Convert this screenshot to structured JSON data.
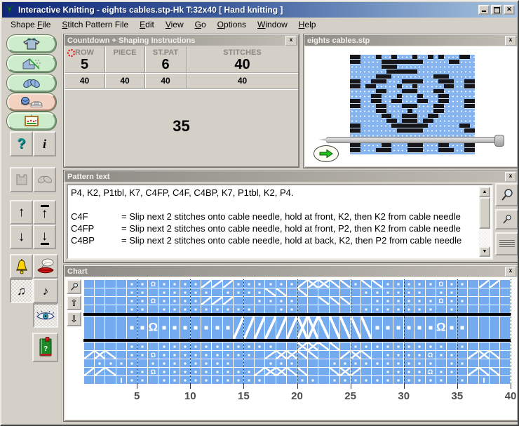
{
  "window": {
    "title": "Interactive Knitting - eights cables.stp-Hk    T:32x40    [ Hand knitting ]",
    "close_glyph": "x"
  },
  "menu": {
    "items": [
      {
        "pre": "Shape ",
        "key": "F",
        "post": "ile"
      },
      {
        "pre": "",
        "key": "S",
        "post": "titch Pattern File"
      },
      {
        "pre": "",
        "key": "E",
        "post": "dit"
      },
      {
        "pre": "",
        "key": "V",
        "post": "iew"
      },
      {
        "pre": "",
        "key": "G",
        "post": "o"
      },
      {
        "pre": "",
        "key": "O",
        "post": "ptions"
      },
      {
        "pre": "",
        "key": "W",
        "post": "indow"
      },
      {
        "pre": "",
        "key": "H",
        "post": "elp"
      }
    ]
  },
  "toolbar": {
    "help_label": "?",
    "info_label": "i",
    "up_label": "↑",
    "down_label": "↓",
    "notes_label": "♫",
    "note_label": "♪",
    "zoom_icon_names": [
      "zoom-in",
      "zoom-out"
    ]
  },
  "countdown": {
    "title": "Countdown + Shaping Instructions",
    "headers": [
      "ROW",
      "PIECE",
      "ST.PAT",
      "STITCHES"
    ],
    "values": [
      "5",
      "",
      "6",
      "40"
    ],
    "row2": [
      "40",
      "40",
      "40",
      "40"
    ],
    "big_value": "35"
  },
  "preview": {
    "title": "eights cables.stp",
    "rows": [
      "##---#--#---#--#-#---##-",
      "##----########-----##---",
      "------###---------------",
      "-------######-----------",
      "-----###--------###-----",
      "##--###---####---###--##",
      "##-##----#--#-----##--##",
      "-----##---###---##------",
      "----##---#---#---##-----",
      "##--##--##---##--##---##",
      "##---##---###---##----##",
      "-----##----#----##------",
      "------##--###--##-------",
      "-------##-###-##--------",
      "##------#######------##-",
      "##-------#####--------##"
    ],
    "rows_below_needle": [
      "##----##---###---##---##",
      "##---###---###---###--##"
    ]
  },
  "pattern_text": {
    "title": "Pattern text",
    "line1": "P4, K2, P1tbl, K7, C4FP, C4F, C4BP, K7, P1tbl, K2, P4.",
    "definitions": [
      {
        "term": "C4F",
        "desc": "= Slip next 2 stitches onto cable needle, hold at front, K2, then K2 from cable needle"
      },
      {
        "term": "C4FP",
        "desc": "= Slip next 2 stitches onto cable needle, hold at front, P2, then K2 from cable needle"
      },
      {
        "term": "C4BP",
        "desc": "= Slip next 2 stitches onto cable needle, hold at back, K2, then P2 from cable needle"
      }
    ]
  },
  "chart": {
    "title": "Chart",
    "cols": 40,
    "x_labels": [
      "5",
      "10",
      "15",
      "20",
      "25",
      "30",
      "35",
      "40"
    ],
    "rows_top": [
      "----..Q....bbb......bxxff.ff.....Q..-bb-",
      "----..-.....-....ff-f-----......-..----",
      "----..Q....bbb--....--fff--......Q..----",
      "----..-.........--..------.......-.-----"
    ],
    "row_current": "----..Q.......bbbbbbxxfffff......Q..----",
    "rows_bottom": [
      "----..-...........--xxff-.........-.----",
      "bxf-..Q.........-bxxff--bxf-....Q..-bxf-",
      "-....-........---...---..........-..----",
      "bbf-..Q.........bxxff--fxb--....Q..-bff-",
      "---|..-..........---..-...........-.-|--"
    ],
    "legend": {
      "dot": "purl",
      "blank": "knit",
      "Q": "twisted stitch",
      "diagonals": "cable cross",
      "slip": "slip"
    },
    "colors": {
      "cell_blue": "#74aaee",
      "grid_white": "#ffffff",
      "separator_black": "#000000"
    }
  },
  "colors": {
    "titlebar_left": "#10277a",
    "titlebar_right": "#a6c4e0",
    "desktop_gray": "#d4d0c8",
    "button_green": "#cdeccb",
    "button_salmon": "#f2d3c2",
    "go_arrow_green": "#22c41e"
  }
}
